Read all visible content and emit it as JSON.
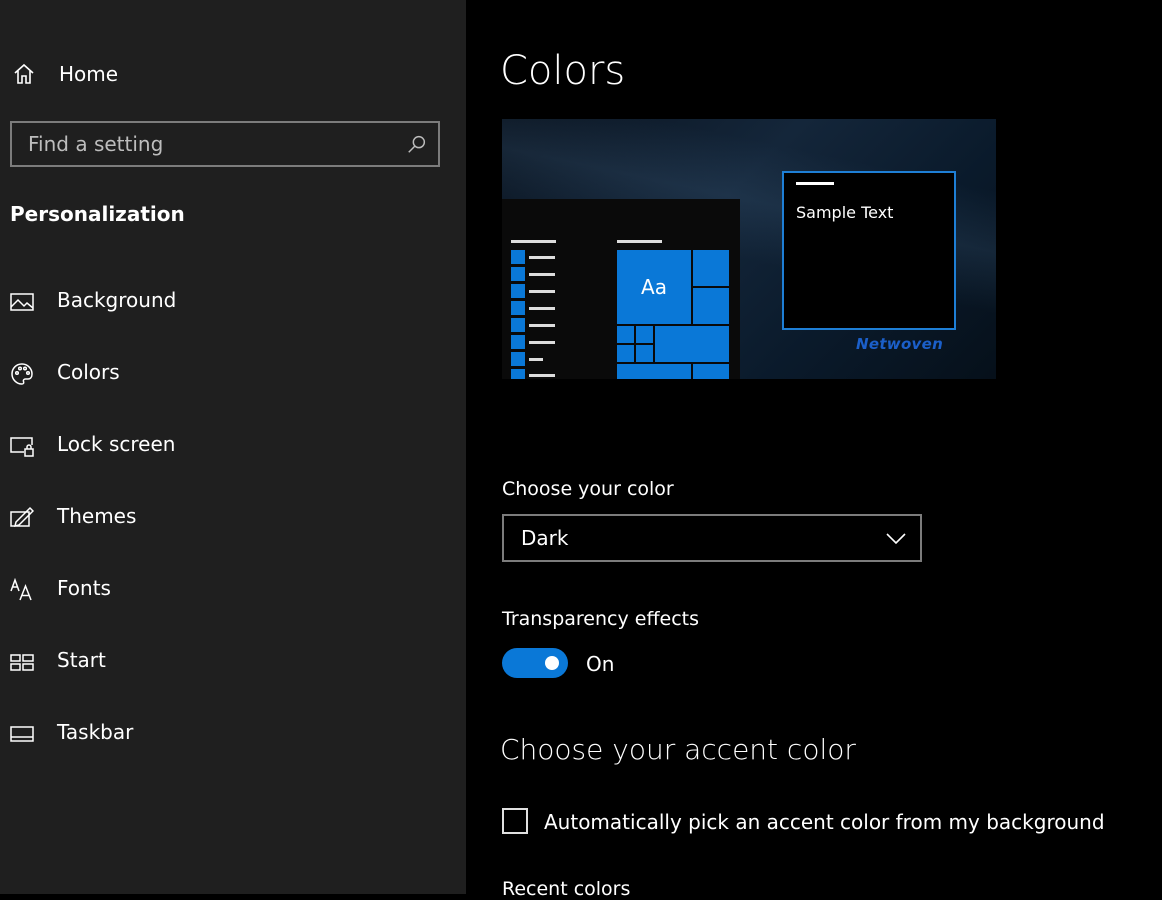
{
  "sidebar": {
    "home_label": "Home",
    "search_placeholder": "Find a setting",
    "section_title": "Personalization",
    "items": [
      {
        "label": "Background",
        "icon": "picture-icon"
      },
      {
        "label": "Colors",
        "icon": "palette-icon"
      },
      {
        "label": "Lock screen",
        "icon": "lock-screen-icon"
      },
      {
        "label": "Themes",
        "icon": "themes-icon"
      },
      {
        "label": "Fonts",
        "icon": "fonts-icon"
      },
      {
        "label": "Start",
        "icon": "start-icon"
      },
      {
        "label": "Taskbar",
        "icon": "taskbar-icon"
      }
    ],
    "selected": "Colors"
  },
  "main": {
    "title": "Colors",
    "preview": {
      "tile_text": "Aa",
      "sample_text": "Sample Text",
      "brand_text": "Netwoven"
    },
    "choose_color": {
      "label": "Choose your color",
      "value": "Dark"
    },
    "transparency": {
      "label": "Transparency effects",
      "state_label": "On",
      "on": true
    },
    "accent_title": "Choose your accent color",
    "auto_pick": {
      "label": "Automatically pick an accent color from my background",
      "checked": false
    },
    "recent_colors_label": "Recent colors"
  },
  "colors": {
    "accent": "#0a78d7",
    "sidebar_bg": "#1f1f1f",
    "main_bg": "#000000",
    "border": "#7c7c7c"
  }
}
